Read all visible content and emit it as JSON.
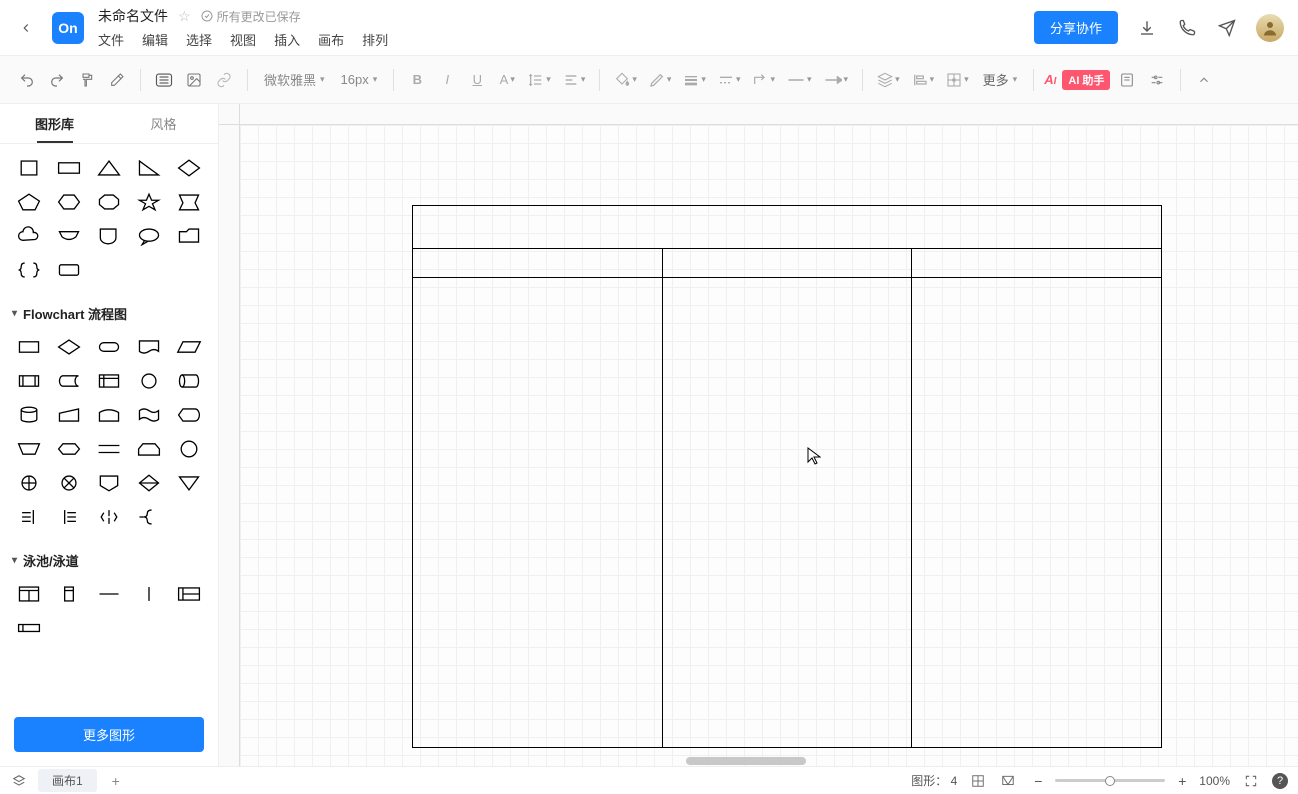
{
  "header": {
    "logo": "On",
    "doc_title": "未命名文件",
    "save_status": "所有更改已保存",
    "menu": [
      "文件",
      "编辑",
      "选择",
      "视图",
      "插入",
      "画布",
      "排列"
    ],
    "share": "分享协作"
  },
  "toolbar": {
    "font_family": "微软雅黑",
    "font_size": "16px",
    "more": "更多",
    "ai": "AI",
    "ai_badge": "AI 助手"
  },
  "sidebar": {
    "tab_shapes": "图形库",
    "tab_styles": "风格",
    "section_flowchart": "Flowchart 流程图",
    "section_pool": "泳池/泳道",
    "more_shapes": "更多图形"
  },
  "status": {
    "page_tab": "画布1",
    "shapes_label": "图形：",
    "shapes_count": "4",
    "zoom": "100%"
  }
}
